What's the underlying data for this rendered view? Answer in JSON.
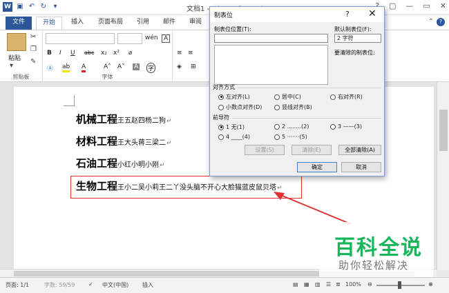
{
  "titlebar": {
    "title": "文档1 - Microsoft Word",
    "app_icon": "W",
    "controls": [
      "?",
      "▢",
      "—",
      "▭",
      "✕"
    ]
  },
  "tabs": [
    "文件",
    "开始",
    "插入",
    "页面布局",
    "引用",
    "邮件",
    "审阅"
  ],
  "ribbon": {
    "paste_label": "粘贴",
    "clipboard_label": "剪贴板",
    "font_label": "字体",
    "buttons": {
      "bold": "B",
      "italic": "I",
      "underline": "U",
      "strike": "abc",
      "subscript": "x₂",
      "superscript": "x²",
      "phonetic": "wén",
      "char_border": "A",
      "grow": "A˄",
      "shrink": "A˅",
      "case": "Aa",
      "clear": "A",
      "enclose": "字"
    }
  },
  "document": {
    "lines": [
      {
        "term": "机械工程",
        "names": "王五赵四杨二狗"
      },
      {
        "term": "材料工程",
        "names": "王大头蒋三梁二"
      },
      {
        "term": "石油工程",
        "names": "小红小明小刚"
      },
      {
        "term": "生物工程",
        "names": "王小二吴小莉王二丫没头脑不开心大脸猫蓝皮鼠贝塔"
      }
    ],
    "paragraph_mark": "↵"
  },
  "dialog": {
    "title": "制表位",
    "help": "?",
    "close": "✕",
    "tab_pos_label": "制表位位置(T):",
    "tab_pos_value": "",
    "default_label": "默认制表位(F):",
    "default_value": "2 字符",
    "clear_label": "要清除的制表位:",
    "align_section": "对齐方式",
    "align_options": [
      {
        "label": "左对齐(L)",
        "checked": true
      },
      {
        "label": "居中(C)",
        "checked": false
      },
      {
        "label": "右对齐(R)",
        "checked": false
      },
      {
        "label": "小数点对齐(D)",
        "checked": false
      },
      {
        "label": "竖线对齐(B)",
        "checked": false
      }
    ],
    "leader_section": "前导符",
    "leader_options": [
      {
        "label": "1 无(1)",
        "checked": true
      },
      {
        "label": "2 ........(2)",
        "checked": false
      },
      {
        "label": "3 ——(3)",
        "checked": false
      },
      {
        "label": "4 ____(4)",
        "checked": false
      },
      {
        "label": "5 ·······(5)",
        "checked": false
      }
    ],
    "set_button": "设置(S)",
    "clear_button": "清除(E)",
    "clear_all_button": "全部清除(A)",
    "ok_button": "确定",
    "cancel_button": "取消"
  },
  "status": {
    "page": "页面: 1/1",
    "words": "字数: 59/59",
    "language": "中文(中国)",
    "mode": "插入",
    "zoom": "100%"
  },
  "watermark": {
    "main": "百科全说",
    "sub": "助你轻松解决"
  },
  "colors": {
    "accent": "#2b579a",
    "highlight_box": "#e03030",
    "watermark_green": "#17b65a"
  }
}
